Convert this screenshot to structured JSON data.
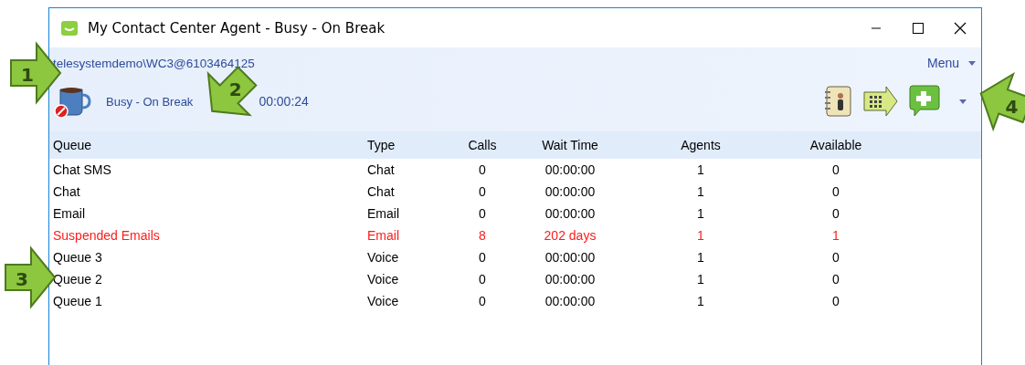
{
  "window": {
    "title": "My Contact Center Agent - Busy - On Break"
  },
  "account": "telesystemdemo\\WC3@6103464125",
  "menu": {
    "label": "Menu"
  },
  "status": {
    "label": "Busy - On Break",
    "timer": "00:00:24"
  },
  "table": {
    "columns": [
      "Queue",
      "Type",
      "Calls",
      "Wait Time",
      "Agents",
      "Available"
    ],
    "rows": [
      {
        "cells": [
          "Chat SMS",
          "Chat",
          "0",
          "00:00:00",
          "1",
          "0"
        ],
        "alert": false
      },
      {
        "cells": [
          "Chat",
          "Chat",
          "0",
          "00:00:00",
          "1",
          "0"
        ],
        "alert": false
      },
      {
        "cells": [
          "Email",
          "Email",
          "0",
          "00:00:00",
          "1",
          "0"
        ],
        "alert": false
      },
      {
        "cells": [
          "Suspended Emails",
          "Email",
          "8",
          "202 days",
          "1",
          "1"
        ],
        "alert": true
      },
      {
        "cells": [
          "Queue 3",
          "Voice",
          "0",
          "00:00:00",
          "1",
          "0"
        ],
        "alert": false
      },
      {
        "cells": [
          "Queue 2",
          "Voice",
          "0",
          "00:00:00",
          "1",
          "0"
        ],
        "alert": false
      },
      {
        "cells": [
          "Queue 1",
          "Voice",
          "0",
          "00:00:00",
          "1",
          "0"
        ],
        "alert": false
      }
    ]
  },
  "callouts": [
    {
      "label": "1"
    },
    {
      "label": "2"
    },
    {
      "label": "3"
    },
    {
      "label": "4"
    }
  ]
}
